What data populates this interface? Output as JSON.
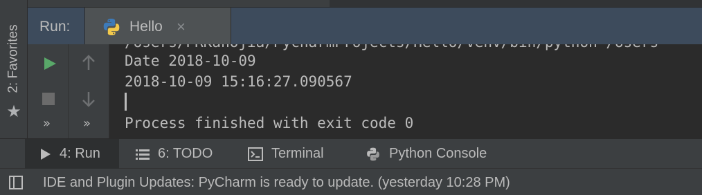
{
  "favorites": {
    "label": "2: Favorites",
    "icon": "star-icon"
  },
  "run_window": {
    "title": "Run:",
    "tab": {
      "label": "Hello",
      "icon": "python-icon",
      "close_icon": "close-icon"
    }
  },
  "toolbar": {
    "rerun_icon": "play-icon",
    "stop_icon": "stop-icon",
    "up_icon": "arrow-up-icon",
    "down_icon": "arrow-down-icon",
    "more_label": "»"
  },
  "console": {
    "lines": [
      "/Users/PRKanojia/PycharmProjects/Hello/venv/bin/python /Users",
      "Date 2018-10-09",
      "2018-10-09 15:16:27.090567",
      "Process finished with exit code 0"
    ]
  },
  "tool_tabs": [
    {
      "label": "4: Run",
      "icon": "run-icon",
      "active": true
    },
    {
      "label": "6: TODO",
      "icon": "list-icon",
      "active": false
    },
    {
      "label": "Terminal",
      "icon": "terminal-icon",
      "active": false
    },
    {
      "label": "Python Console",
      "icon": "python-icon",
      "active": false
    }
  ],
  "status_bar": {
    "icon": "panel-toggle-icon",
    "message": "IDE and Plugin Updates: PyCharm is ready to update. (yesterday 10:28 PM)"
  },
  "colors": {
    "header_bg": "#3d4b5c",
    "console_bg": "#2b2b2b",
    "run_green": "#59a869",
    "text": "#bbbbbb"
  }
}
